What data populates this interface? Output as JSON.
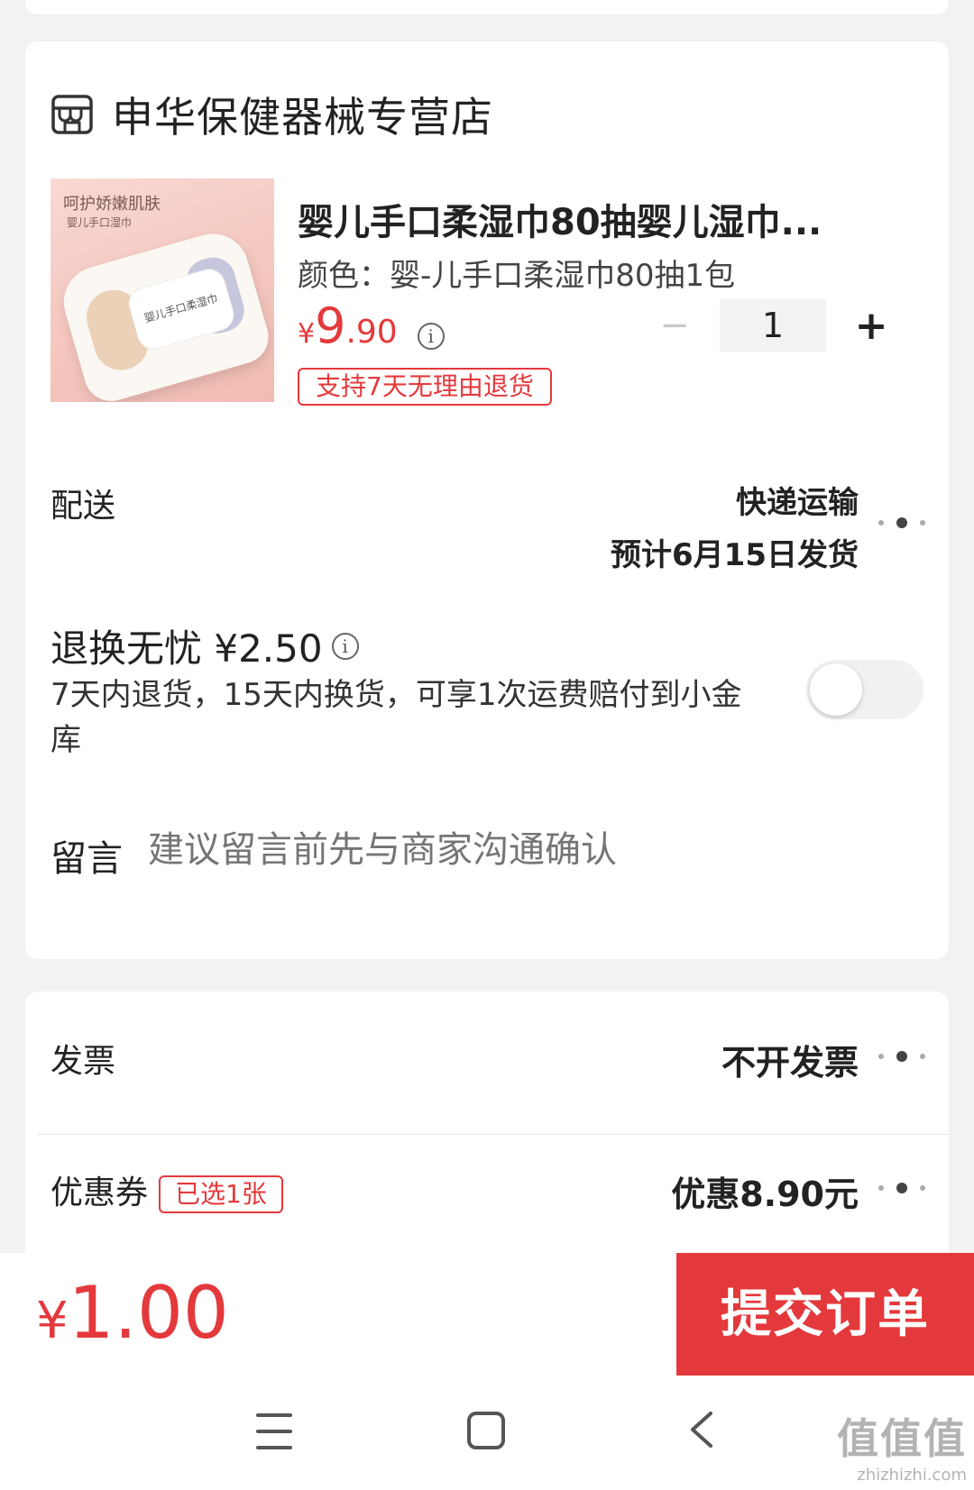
{
  "store": {
    "name": "申华保健器械专营店",
    "icon": "store-icon"
  },
  "product": {
    "image_text_line1": "呵护娇嫩肌肤",
    "image_text_line2": "婴儿手口湿巾",
    "image_pack_text": "婴儿手口柔湿巾",
    "title": "婴儿手口柔湿巾80抽婴儿湿巾...",
    "spec": "颜色：婴-儿手口柔湿巾80抽1包",
    "price_symbol": "¥",
    "price_int": "9",
    "price_dec": ".90",
    "quantity": "1",
    "minus": "−",
    "plus": "+",
    "return_tag": "支持7天无理由退货"
  },
  "delivery": {
    "label": "配送",
    "method": "快递运输",
    "eta": "预计6月15日发货"
  },
  "return_insurance": {
    "title": "退换无忧 ¥2.50",
    "desc": "7天内退货，15天内换货，可享1次运费赔付到小金库",
    "enabled": false
  },
  "message": {
    "label": "留言",
    "placeholder": "建议留言前先与商家沟通确认"
  },
  "invoice": {
    "label": "发票",
    "value": "不开发票"
  },
  "coupon": {
    "label": "优惠券",
    "tag": "已选1张",
    "value": "优惠8.90元"
  },
  "bottom": {
    "total_symbol": "¥",
    "total_value": "1.00",
    "submit_label": "提交订单"
  },
  "watermark": {
    "big": "值值值",
    "small": "zhizhizhi.com"
  },
  "colors": {
    "accent": "#e4393c"
  }
}
